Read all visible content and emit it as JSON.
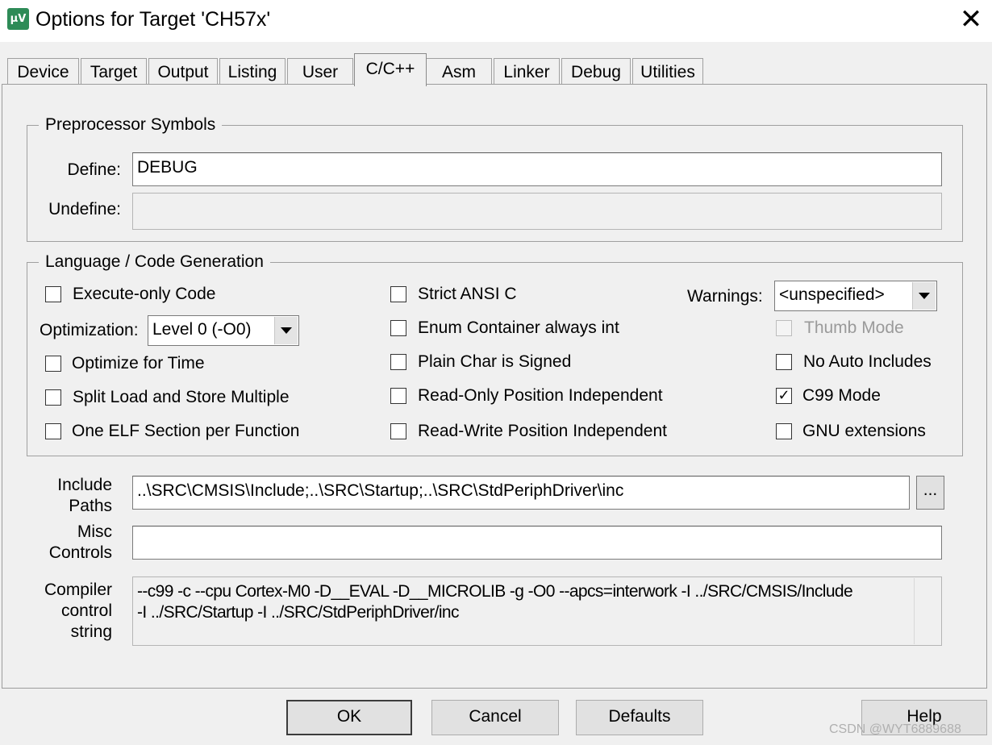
{
  "window": {
    "title": "Options for Target 'CH57x'",
    "app_icon_text": "µV"
  },
  "tabs": [
    {
      "label": "Device"
    },
    {
      "label": "Target"
    },
    {
      "label": "Output"
    },
    {
      "label": "Listing"
    },
    {
      "label": "User"
    },
    {
      "label": "C/C++"
    },
    {
      "label": "Asm"
    },
    {
      "label": "Linker"
    },
    {
      "label": "Debug"
    },
    {
      "label": "Utilities"
    }
  ],
  "active_tab": "C/C++",
  "preprocessor": {
    "title": "Preprocessor Symbols",
    "define_label": "Define:",
    "define_value": "DEBUG",
    "undefine_label": "Undefine:",
    "undefine_value": ""
  },
  "language": {
    "title": "Language / Code Generation",
    "execute_only": {
      "label": "Execute-only Code",
      "checked": false
    },
    "optimization_label": "Optimization:",
    "optimization_value": "Level 0 (-O0)",
    "optimize_time": {
      "label": "Optimize for Time",
      "checked": false
    },
    "split_load": {
      "label": "Split Load and Store Multiple",
      "checked": false
    },
    "one_elf": {
      "label": "One ELF Section per Function",
      "checked": false
    },
    "strict_ansi": {
      "label": "Strict ANSI C",
      "checked": false
    },
    "enum_container": {
      "label": "Enum Container always int",
      "checked": false
    },
    "plain_char": {
      "label": "Plain Char is Signed",
      "checked": false
    },
    "ro_pi": {
      "label": "Read-Only Position Independent",
      "checked": false
    },
    "rw_pi": {
      "label": "Read-Write Position Independent",
      "checked": false
    },
    "warnings_label": "Warnings:",
    "warnings_value": "<unspecified>",
    "thumb_mode": {
      "label": "Thumb Mode",
      "checked": false,
      "disabled": true
    },
    "no_auto_includes": {
      "label": "No Auto Includes",
      "checked": false
    },
    "c99_mode": {
      "label": "C99 Mode",
      "checked": true
    },
    "gnu_ext": {
      "label": "GNU extensions",
      "checked": false
    }
  },
  "include_paths": {
    "label_line1": "Include",
    "label_line2": "Paths",
    "value": "..\\SRC\\CMSIS\\Include;..\\SRC\\Startup;..\\SRC\\StdPeriphDriver\\inc",
    "browse_label": "..."
  },
  "misc_controls": {
    "label_line1": "Misc",
    "label_line2": "Controls",
    "value": ""
  },
  "compiler_control": {
    "label_line1": "Compiler",
    "label_line2": "control",
    "label_line3": "string",
    "line1": "--c99 -c --cpu Cortex-M0 -D__EVAL -D__MICROLIB -g -O0 --apcs=interwork -I ../SRC/CMSIS/Include",
    "line2": "-I ../SRC/Startup -I ../SRC/StdPeriphDriver/inc"
  },
  "buttons": {
    "ok": "OK",
    "cancel": "Cancel",
    "defaults": "Defaults",
    "help": "Help"
  },
  "watermark": "CSDN @WYT6889688"
}
